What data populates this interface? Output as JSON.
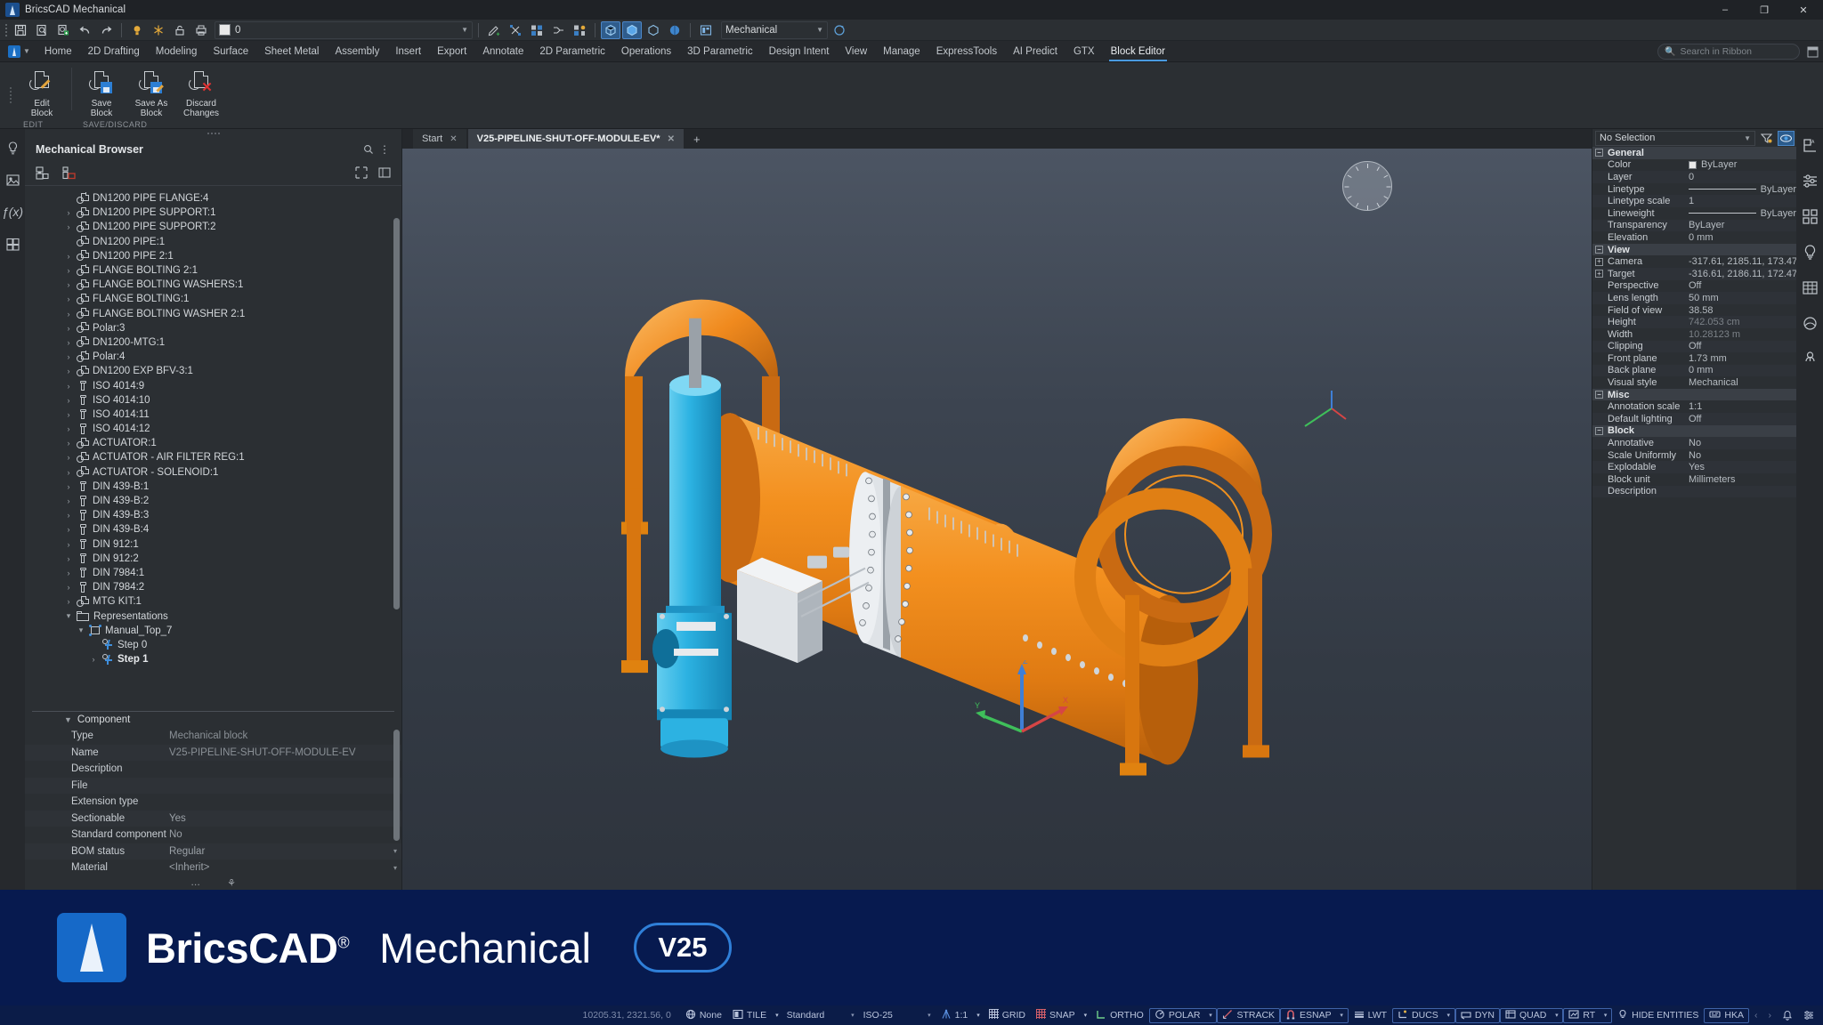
{
  "window": {
    "title": "BricsCAD Mechanical",
    "minimize": "–",
    "maximize": "❐",
    "close": "✕"
  },
  "quick_access": {
    "buttons": [
      "save-icon",
      "print-preview-icon",
      "plot-icon",
      "undo-icon",
      "redo-icon"
    ],
    "layer_state_icons": [
      "lightbulb-icon",
      "freeze-icon",
      "lock-icon",
      "plot-layer-icon"
    ],
    "layer_value": "0",
    "tool_icons": [
      "layer-new-icon",
      "layer-tools-icon",
      "layer-properties-icon",
      "layer-merge-icon",
      "layer-state-icon"
    ],
    "view_icons": [
      "view-iso-icon",
      "view-shaded-icon",
      "view-wireframe-icon",
      "view-render-icon"
    ],
    "workspace_icon": "workspace-icon",
    "workspace_value": "Mechanical",
    "help_icon": "help-icon"
  },
  "ribbon": {
    "tabs": [
      "Home",
      "2D Drafting",
      "Modeling",
      "Surface",
      "Sheet Metal",
      "Assembly",
      "Insert",
      "Export",
      "Annotate",
      "2D Parametric",
      "Operations",
      "3D Parametric",
      "Design Intent",
      "View",
      "Manage",
      "ExpressTools",
      "AI Predict",
      "GTX",
      "Block Editor"
    ],
    "active_tab": "Block Editor",
    "search_placeholder": "Search in Ribbon",
    "groups": [
      {
        "title": "EDIT",
        "buttons": [
          {
            "label": "Edit\nBlock",
            "label_l1": "Edit",
            "label_l2": "Block",
            "icon": "edit-block-icon"
          }
        ]
      },
      {
        "title": "SAVE/DISCARD",
        "buttons": [
          {
            "label_l1": "Save",
            "label_l2": "Block",
            "icon": "save-block-icon"
          },
          {
            "label_l1": "Save As",
            "label_l2": "Block",
            "icon": "save-as-block-icon"
          },
          {
            "label_l1": "Discard",
            "label_l2": "Changes",
            "icon": "discard-changes-icon"
          }
        ]
      }
    ]
  },
  "document_tabs": {
    "tabs": [
      {
        "label": "Start",
        "active": false
      },
      {
        "label": "V25-PIPELINE-SHUT-OFF-MODULE-EV*",
        "active": true
      }
    ],
    "close_glyph": "✕",
    "add_glyph": "+"
  },
  "browser": {
    "title": "Mechanical Browser",
    "header_icons": [
      "search-icon",
      "more-options-icon"
    ],
    "toolbar_icons": [
      "insert-component-icon",
      "new-component-icon"
    ],
    "tree": [
      {
        "label": "DN1200 PIPE FLANGE:4",
        "icon": "component-icon",
        "arrow": false,
        "depth": 0
      },
      {
        "label": "DN1200 PIPE SUPPORT:1",
        "icon": "component-icon",
        "arrow": true,
        "depth": 0
      },
      {
        "label": "DN1200 PIPE SUPPORT:2",
        "icon": "component-icon",
        "arrow": true,
        "depth": 0
      },
      {
        "label": "DN1200 PIPE:1",
        "icon": "component-icon",
        "arrow": false,
        "depth": 0
      },
      {
        "label": "DN1200 PIPE 2:1",
        "icon": "component-icon",
        "arrow": true,
        "depth": 0
      },
      {
        "label": "FLANGE  BOLTING 2:1",
        "icon": "component-icon",
        "arrow": true,
        "depth": 0
      },
      {
        "label": "FLANGE BOLTING WASHERS:1",
        "icon": "component-icon",
        "arrow": true,
        "depth": 0
      },
      {
        "label": "FLANGE BOLTING:1",
        "icon": "component-icon",
        "arrow": true,
        "depth": 0
      },
      {
        "label": "FLANGE BOLTING WASHER 2:1",
        "icon": "component-icon",
        "arrow": true,
        "depth": 0
      },
      {
        "label": "Polar:3",
        "icon": "component-icon",
        "arrow": true,
        "depth": 0
      },
      {
        "label": "DN1200-MTG:1",
        "icon": "component-icon",
        "arrow": true,
        "depth": 0
      },
      {
        "label": "Polar:4",
        "icon": "component-icon",
        "arrow": true,
        "depth": 0
      },
      {
        "label": "DN1200 EXP BFV-3:1",
        "icon": "component-icon",
        "arrow": true,
        "depth": 0
      },
      {
        "label": "ISO 4014:9",
        "icon": "bolt-icon",
        "arrow": true,
        "depth": 0
      },
      {
        "label": "ISO 4014:10",
        "icon": "bolt-icon",
        "arrow": true,
        "depth": 0
      },
      {
        "label": "ISO 4014:11",
        "icon": "bolt-icon",
        "arrow": true,
        "depth": 0
      },
      {
        "label": "ISO 4014:12",
        "icon": "bolt-icon",
        "arrow": true,
        "depth": 0
      },
      {
        "label": "ACTUATOR:1",
        "icon": "component-icon",
        "arrow": true,
        "depth": 0
      },
      {
        "label": "ACTUATOR - AIR FILTER REG:1",
        "icon": "component-icon",
        "arrow": true,
        "depth": 0
      },
      {
        "label": "ACTUATOR - SOLENOID:1",
        "icon": "component-icon",
        "arrow": true,
        "depth": 0
      },
      {
        "label": "DIN 439-B:1",
        "icon": "bolt-icon",
        "arrow": true,
        "depth": 0
      },
      {
        "label": "DIN 439-B:2",
        "icon": "bolt-icon",
        "arrow": true,
        "depth": 0
      },
      {
        "label": "DIN 439-B:3",
        "icon": "bolt-icon",
        "arrow": true,
        "depth": 0
      },
      {
        "label": "DIN 439-B:4",
        "icon": "bolt-icon",
        "arrow": true,
        "depth": 0
      },
      {
        "label": "DIN 912:1",
        "icon": "bolt-icon",
        "arrow": true,
        "depth": 0
      },
      {
        "label": "DIN 912:2",
        "icon": "bolt-icon",
        "arrow": true,
        "depth": 0
      },
      {
        "label": "DIN 7984:1",
        "icon": "bolt-icon",
        "arrow": true,
        "depth": 0
      },
      {
        "label": "DIN 7984:2",
        "icon": "bolt-icon",
        "arrow": true,
        "depth": 0
      },
      {
        "label": "MTG KIT:1",
        "icon": "component-icon",
        "arrow": true,
        "depth": 0
      },
      {
        "label": "Representations",
        "icon": "folder-icon",
        "arrow": true,
        "expanded": true,
        "depth": 0
      },
      {
        "label": "Manual_Top_7",
        "icon": "representation-icon",
        "arrow": true,
        "expanded": true,
        "depth": 1
      },
      {
        "label": "Step 0",
        "icon": "step-icon",
        "arrow": false,
        "depth": 2
      },
      {
        "label": "Step 1",
        "icon": "step-icon",
        "arrow": true,
        "depth": 2,
        "bold": true
      }
    ]
  },
  "component_panel": {
    "title": "Component",
    "rows": [
      {
        "key": "Type",
        "value": "Mechanical block",
        "dim": true
      },
      {
        "key": "Name",
        "value": "V25-PIPELINE-SHUT-OFF-MODULE-EV",
        "dim": true
      },
      {
        "key": "Description",
        "value": ""
      },
      {
        "key": "File",
        "value": ""
      },
      {
        "key": "Extension type",
        "value": ""
      },
      {
        "key": "Sectionable",
        "value": "Yes"
      },
      {
        "key": "Standard component",
        "value": "No"
      },
      {
        "key": "BOM status",
        "value": "Regular"
      },
      {
        "key": "Material",
        "value": "<Inherit>"
      }
    ],
    "footer_icons": [
      "more-icon",
      "settings-icon"
    ]
  },
  "properties": {
    "selection": "No Selection",
    "toolbar_icons": [
      "filter-icon",
      "quick-select-icon"
    ],
    "groups": [
      {
        "name": "General",
        "rows": [
          {
            "key": "Color",
            "value": "ByLayer",
            "type": "color"
          },
          {
            "key": "Layer",
            "value": "0"
          },
          {
            "key": "Linetype",
            "value": "ByLayer",
            "type": "line"
          },
          {
            "key": "Linetype scale",
            "value": "1"
          },
          {
            "key": "Lineweight",
            "value": "ByLayer",
            "type": "line"
          },
          {
            "key": "Transparency",
            "value": "ByLayer"
          },
          {
            "key": "Elevation",
            "value": "0 mm"
          }
        ]
      },
      {
        "name": "View",
        "rows": [
          {
            "key": "Camera",
            "value": "-317.61, 2185.11, 173.47",
            "expandable": true
          },
          {
            "key": "Target",
            "value": "-316.61, 2186.11, 172.47",
            "expandable": true
          },
          {
            "key": "Perspective",
            "value": "Off"
          },
          {
            "key": "Lens length",
            "value": "50 mm"
          },
          {
            "key": "Field of view",
            "value": "38.58"
          },
          {
            "key": "Height",
            "value": "742.053 cm",
            "grey": true
          },
          {
            "key": "Width",
            "value": "10.28123 m",
            "grey": true
          },
          {
            "key": "Clipping",
            "value": "Off"
          },
          {
            "key": "Front plane",
            "value": "1.73 mm"
          },
          {
            "key": "Back plane",
            "value": "0 mm"
          },
          {
            "key": "Visual style",
            "value": "Mechanical"
          }
        ]
      },
      {
        "name": "Misc",
        "rows": [
          {
            "key": "Annotation scale",
            "value": "1:1"
          },
          {
            "key": "Default lighting",
            "value": "Off"
          }
        ]
      },
      {
        "name": "Block",
        "rows": [
          {
            "key": "Annotative",
            "value": "No"
          },
          {
            "key": "Scale Uniformly",
            "value": "No"
          },
          {
            "key": "Explodable",
            "value": "Yes"
          },
          {
            "key": "Block unit",
            "value": "Millimeters"
          },
          {
            "key": "Description",
            "value": ""
          }
        ]
      }
    ]
  },
  "right_rail": {
    "icons": [
      "sheet-metal-icon",
      "settings-sliders-icon",
      "blocks-library-icon",
      "lighting-icon",
      "table-icon",
      "render-materials-icon",
      "structure-icon"
    ]
  },
  "left_rail": {
    "icons": [
      "lighting-panel-icon",
      "render-icon",
      "parameters-icon",
      "mechanical-browser-icon"
    ]
  },
  "banner": {
    "brand": "BricsCAD",
    "trademark": "®",
    "product": "Mechanical",
    "version": "V25",
    "bg_color": "#071a4f",
    "accent_color": "#2f7fd8"
  },
  "statusbar": {
    "coordinates": "10205.31, 2321.56, 0",
    "items": [
      {
        "label": "None",
        "icon": "globe-icon",
        "type": "plain"
      },
      {
        "label": "TILE",
        "icon": "tile-icon",
        "type": "dropdown"
      },
      {
        "label": "Standard",
        "type": "dropdown-wide"
      },
      {
        "label": "ISO-25",
        "type": "dropdown-wide"
      },
      {
        "label": "1:1",
        "icon": "scale-icon",
        "type": "dropdown"
      },
      {
        "label": "GRID",
        "icon": "grid-icon",
        "type": "plain"
      },
      {
        "label": "SNAP",
        "icon": "snap-icon",
        "type": "dropdown"
      },
      {
        "label": "ORTHO",
        "icon": "ortho-icon",
        "type": "plain"
      },
      {
        "label": "POLAR",
        "icon": "polar-icon",
        "type": "dropdown",
        "active": true
      },
      {
        "label": "STRACK",
        "icon": "strack-icon",
        "type": "boxed",
        "active": true
      },
      {
        "label": "ESNAP",
        "icon": "esnap-icon",
        "type": "dropdown",
        "active": true
      },
      {
        "label": "LWT",
        "icon": "lwt-icon",
        "type": "plain"
      },
      {
        "label": "DUCS",
        "icon": "ducs-icon",
        "type": "dropdown",
        "active": true
      },
      {
        "label": "DYN",
        "icon": "dyn-icon",
        "type": "boxed",
        "active": true
      },
      {
        "label": "QUAD",
        "icon": "quad-icon",
        "type": "dropdown",
        "active": true
      },
      {
        "label": "RT",
        "icon": "rt-icon",
        "type": "dropdown",
        "active": true
      },
      {
        "label": "HIDE ENTITIES",
        "icon": "bulb-icon",
        "type": "plain"
      },
      {
        "label": "HKA",
        "icon": "hka-icon",
        "type": "boxed",
        "active": true
      }
    ],
    "nav_prev": "‹",
    "nav_next": "›",
    "bell_icon": "bell-icon",
    "settings_icon": "status-settings-icon",
    "bg_color": "#0b1c48"
  },
  "model": {
    "body_color": "#f08a1e",
    "body_color_dark": "#c96a12",
    "actuator_color": "#2fb3e0",
    "hardware_color": "#c8ccd0"
  }
}
